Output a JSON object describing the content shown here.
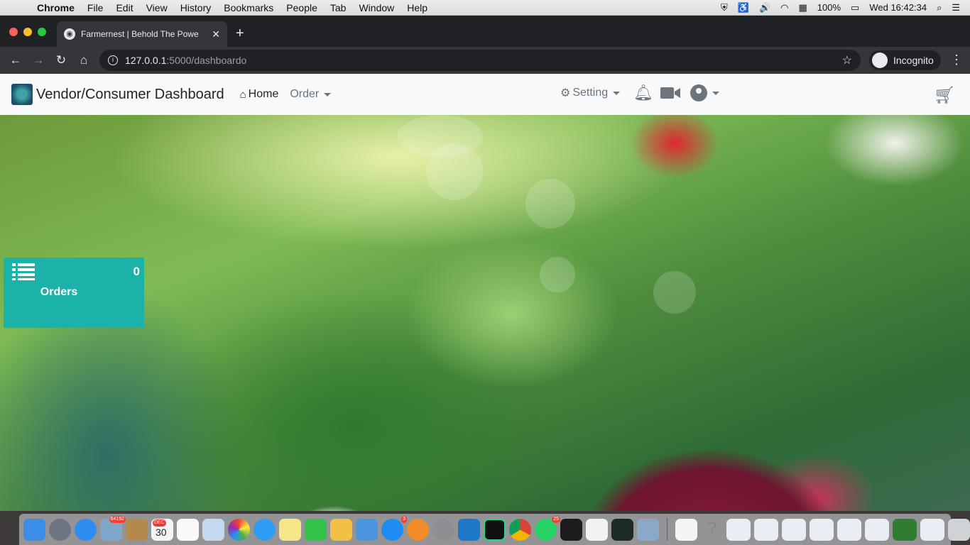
{
  "menubar": {
    "app": "Chrome",
    "items": [
      "File",
      "Edit",
      "View",
      "History",
      "Bookmarks",
      "People",
      "Tab",
      "Window",
      "Help"
    ],
    "battery": "100%",
    "clock": "Wed 16:42:34"
  },
  "browser": {
    "tab_title": "Farmernest | Behold The Powe",
    "url_host": "127.0.0.1",
    "url_path": ":5000/dashboardo",
    "incognito_label": "Incognito"
  },
  "navbar": {
    "brand": "Vendor/Consumer Dashboard",
    "home_label": "Home",
    "order_label": "Order",
    "setting_label": "Setting"
  },
  "orders_card": {
    "count": "0",
    "label": "Orders",
    "color": "#1bb2a9"
  },
  "dock": {
    "badges": {
      "mail": "64192",
      "calendar_month": "DEC",
      "calendar_day": "30",
      "appstore": "3",
      "whatsapp": "25"
    }
  }
}
